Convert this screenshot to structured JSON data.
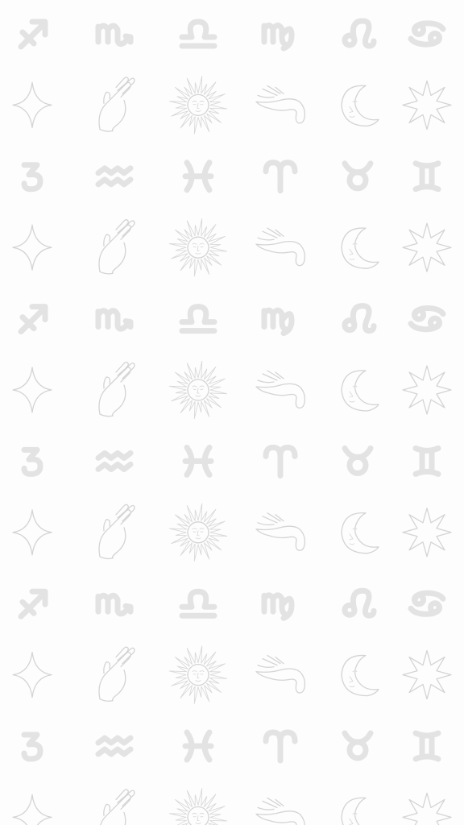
{
  "wallpaper": {
    "background_color": "#fdfdfd",
    "glyph_color": "#e3e3e3",
    "line_color": "#d4d4d4",
    "zodiac_row_a": [
      "sagittarius-icon",
      "scorpio-icon",
      "libra-icon",
      "virgo-icon",
      "leo-icon",
      "cancer-icon"
    ],
    "zodiac_row_b": [
      "capricorn-icon",
      "aquarius-icon",
      "pisces-icon",
      "aries-icon",
      "taurus-icon",
      "gemini-icon"
    ],
    "celestial_row": [
      "four-point-star-icon",
      "reaching-hand-icon",
      "sun-face-icon",
      "pointing-hand-icon",
      "crescent-moon-face-icon",
      "eight-point-star-icon"
    ],
    "row_sequence": [
      "zodiac_row_a",
      "celestial_row",
      "zodiac_row_b",
      "celestial_row",
      "zodiac_row_a",
      "celestial_row",
      "zodiac_row_b",
      "celestial_row",
      "zodiac_row_a",
      "celestial_row",
      "zodiac_row_b",
      "celestial_row"
    ]
  }
}
